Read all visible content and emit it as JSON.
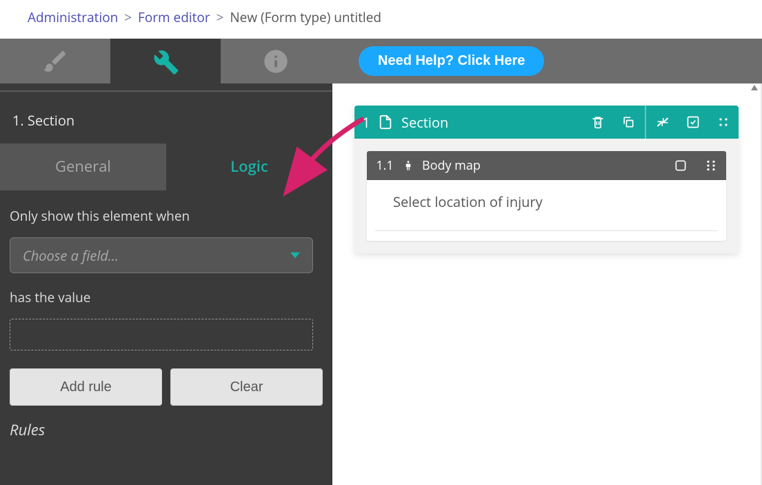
{
  "breadcrumb": {
    "items": [
      "Administration",
      "Form editor"
    ],
    "current": "New (Form type) untitled"
  },
  "topbar": {
    "help_label": "Need Help? Click Here"
  },
  "left": {
    "section_label": "1. Section",
    "tabs": {
      "general": "General",
      "logic": "Logic"
    },
    "logic": {
      "show_when_label": "Only show this element when",
      "field_placeholder": "Choose a field...",
      "has_value_label": "has the value",
      "add_rule_label": "Add rule",
      "clear_label": "Clear",
      "rules_heading": "Rules"
    }
  },
  "right": {
    "section": {
      "number": "1",
      "title": "Section",
      "item": {
        "number": "1.1",
        "title": "Body map",
        "prompt": "Select location of injury"
      }
    }
  }
}
